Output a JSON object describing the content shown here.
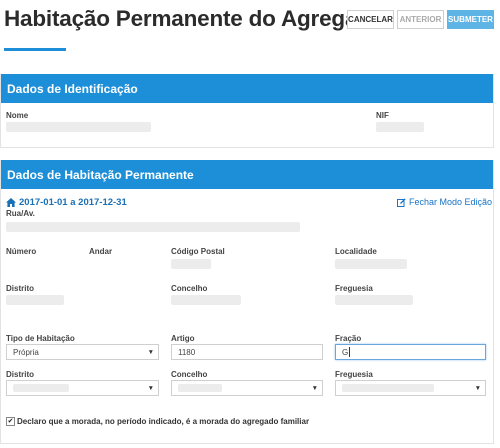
{
  "header": {
    "title": "Habitação Permanente do Agregado",
    "buttons": {
      "cancel": "CANCELAR",
      "previous": "ANTERIOR",
      "submit": "SUBMETER"
    }
  },
  "identification": {
    "title": "Dados de Identificação",
    "name_label": "Nome",
    "nif_label": "NIF"
  },
  "residence": {
    "title": "Dados de Habitação Permanente",
    "period": "2017-01-01 a 2017-12-31",
    "close_edit": "Fechar Modo Edição",
    "labels": {
      "street": "Rua/Av.",
      "number": "Número",
      "floor": "Andar",
      "postal_code": "Código Postal",
      "locality": "Localidade",
      "district": "Distrito",
      "municipality": "Concelho",
      "parish": "Freguesia"
    },
    "form": {
      "housing_type_label": "Tipo de Habitação",
      "housing_type_value": "Própria",
      "article_label": "Artigo",
      "article_value": "1180",
      "fraction_label": "Fração",
      "fraction_value": "G",
      "district_label": "Distrito",
      "municipality_label": "Concelho",
      "parish_label": "Freguesia"
    },
    "declaration": "Declaro que a morada, no período indicado, é a morada do agregado familiar",
    "declaration_checked": true
  },
  "colors": {
    "accent": "#1d8fd8",
    "submit": "#5fb4e6",
    "link": "#1a6fb5"
  },
  "icons": {
    "home": "home-icon",
    "edit": "edit-icon",
    "caret": "caret-down-icon",
    "check": "check-icon"
  }
}
